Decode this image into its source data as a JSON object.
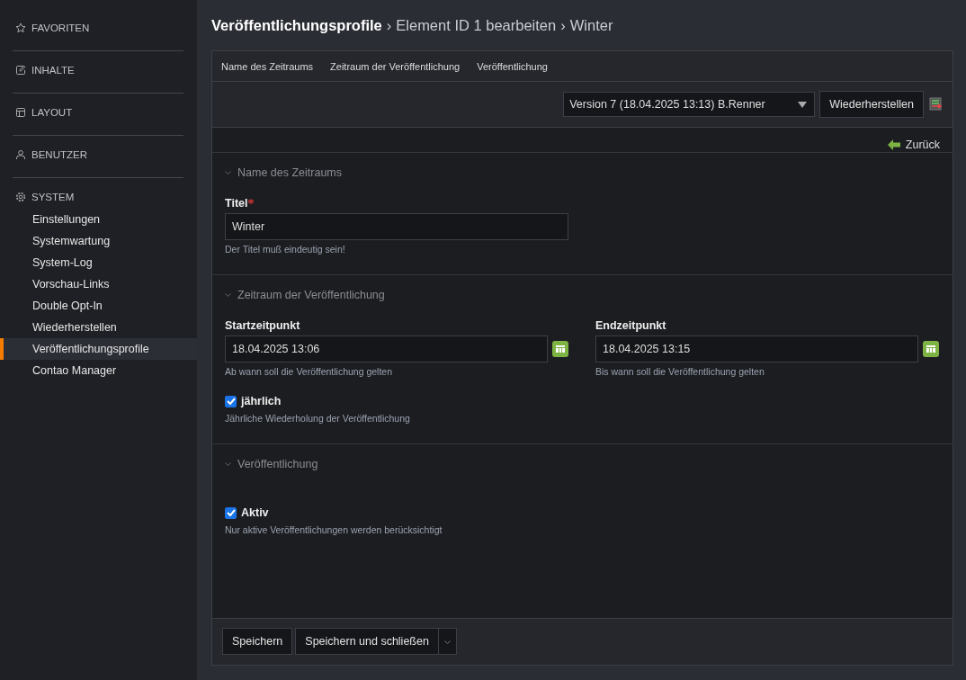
{
  "sidebar": {
    "groups": [
      {
        "label": "FAVORITEN"
      },
      {
        "label": "INHALTE"
      },
      {
        "label": "LAYOUT"
      },
      {
        "label": "BENUTZER"
      },
      {
        "label": "SYSTEM",
        "items": [
          {
            "label": "Einstellungen",
            "selected": false
          },
          {
            "label": "Systemwartung",
            "selected": false
          },
          {
            "label": "System-Log",
            "selected": false
          },
          {
            "label": "Vorschau-Links",
            "selected": false
          },
          {
            "label": "Double Opt-In",
            "selected": false
          },
          {
            "label": "Wiederherstellen",
            "selected": false
          },
          {
            "label": "Veröffentlichungsprofile",
            "selected": true
          },
          {
            "label": "Contao Manager",
            "selected": false
          }
        ]
      }
    ]
  },
  "breadcrumb": {
    "separator": "›",
    "items": [
      "Veröffentlichungsprofile",
      "Element ID 1 bearbeiten",
      "Winter"
    ]
  },
  "jump_links": [
    "Name des Zeitraums",
    "Zeitraum der Veröffentlichung",
    "Veröffentlichung"
  ],
  "version_bar": {
    "version": "Version 7 (18.04.2025 13:13) B.Renner",
    "restore_button": "Wiederherstellen"
  },
  "back_link": "Zurück",
  "sections": [
    {
      "legend": "Name des Zeitraums",
      "rows": [
        [
          {
            "kind": "text",
            "label": "Titel",
            "required": true,
            "value": "Winter",
            "help": "Der Titel muß eindeutig sein!"
          }
        ]
      ]
    },
    {
      "legend": "Zeitraum der Veröffentlichung",
      "rows": [
        [
          {
            "kind": "date",
            "label": "Startzeitpunkt",
            "required": false,
            "value": "18.04.2025 13:06",
            "help": "Ab wann soll die Veröffentlichung gelten"
          },
          {
            "kind": "date",
            "label": "Endzeitpunkt",
            "required": false,
            "value": "18.04.2025 13:15",
            "help": "Bis wann soll die Veröffentlichung gelten"
          }
        ],
        [
          {
            "kind": "checkbox",
            "label": "jährlich",
            "checked": true,
            "help": "Jährliche Wiederholung der Veröffentlichung"
          }
        ]
      ]
    },
    {
      "legend": "Veröffentlichung",
      "rows": [
        [
          {
            "kind": "checkbox",
            "label": "Aktiv",
            "checked": true,
            "help": "Nur aktive Veröffentlichungen werden berücksichtigt"
          }
        ]
      ]
    }
  ],
  "buttons": {
    "save": "Speichern",
    "save_close": "Speichern und schließen"
  }
}
